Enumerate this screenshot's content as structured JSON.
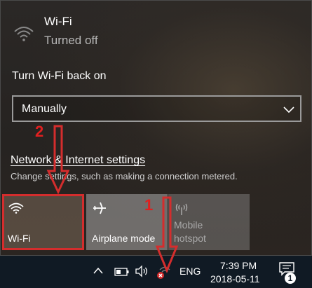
{
  "wifi": {
    "name": "Wi-Fi",
    "status": "Turned off",
    "turn_back_on_label": "Turn Wi-Fi back on",
    "turn_back_on_value": "Manually"
  },
  "network": {
    "settings_link": "Network & Internet settings",
    "settings_description": "Change settings, such as making a connection metered."
  },
  "quick_actions": [
    {
      "label": "Wi-Fi",
      "icon": "wifi-icon",
      "selected": true
    },
    {
      "label": "Airplane mode",
      "icon": "airplane-icon"
    },
    {
      "label_line1": "Mobile",
      "label_line2": "hotspot",
      "icon": "hotspot-icon",
      "disabled": true
    }
  ],
  "taskbar": {
    "language": "ENG",
    "time": "7:39 PM",
    "date": "2018-05-11",
    "notification_count": "1",
    "icons": [
      "chevron-up-icon",
      "battery-icon",
      "volume-icon",
      "network-disconnected-icon",
      "action-center-icon"
    ]
  },
  "annotations": {
    "step_1": "1",
    "step_2": "2",
    "color": "#d42d2d"
  },
  "colors": {
    "taskbar_bg": "#101a24",
    "annotation": "#d42d2d"
  }
}
